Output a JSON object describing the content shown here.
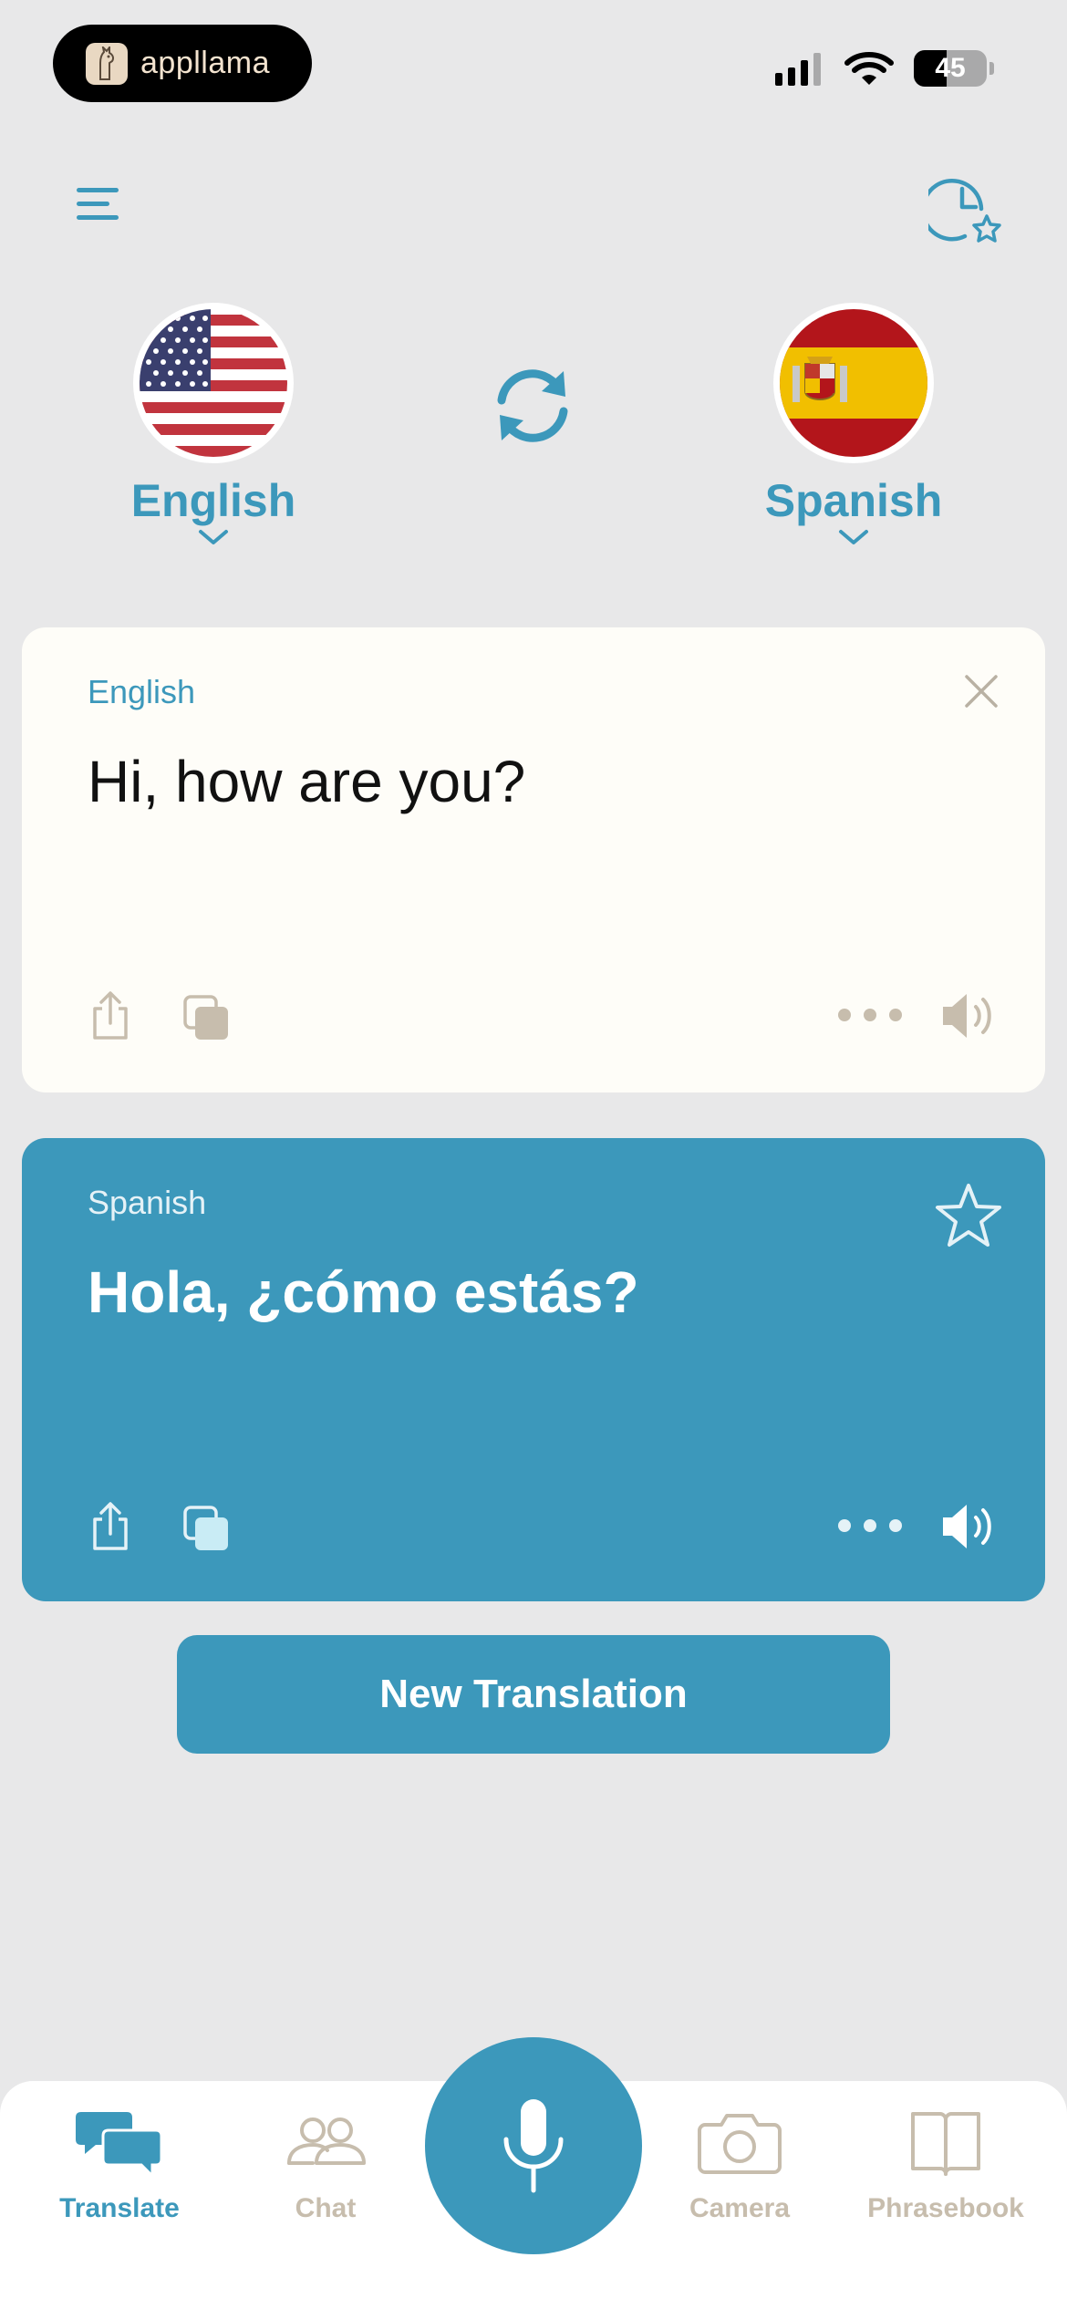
{
  "status_bar": {
    "app_pill": "appllama",
    "battery": "45",
    "battery_level": 0.45
  },
  "languages": {
    "source": "English",
    "target": "Spanish"
  },
  "source_card": {
    "label": "English",
    "text": "Hi, how are you?"
  },
  "target_card": {
    "label": "Spanish",
    "text": "Hola, ¿cómo estás?"
  },
  "new_translation_button": "New Translation",
  "tabs": [
    {
      "label": "Translate",
      "icon": "chat-bubbles-icon",
      "active": true
    },
    {
      "label": "Chat",
      "icon": "people-icon",
      "active": false
    },
    {
      "label": "Camera",
      "icon": "camera-icon",
      "active": false
    },
    {
      "label": "Phrasebook",
      "icon": "book-icon",
      "active": false
    }
  ],
  "colors": {
    "accent": "#3c98bb",
    "background": "#e8e8e9",
    "source_card": "#fefdf8",
    "inactive_icon": "#c7bdad"
  }
}
